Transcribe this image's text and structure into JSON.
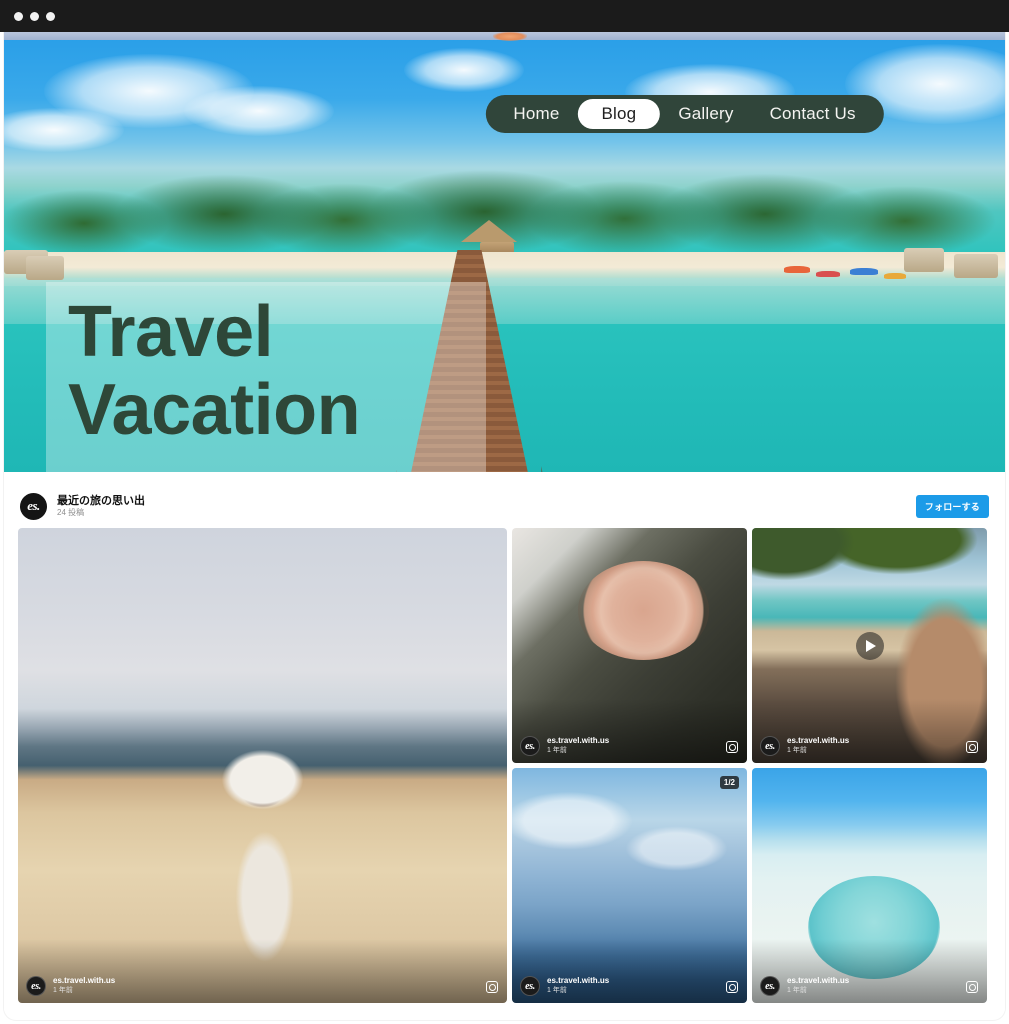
{
  "window": {
    "traffic_dots": [
      "dot-1",
      "dot-2",
      "dot-3"
    ]
  },
  "hero": {
    "title_line1": "Travel",
    "title_line2": "Vacation",
    "overlay_color": "#ffffff",
    "title_color": "#2e4738",
    "nav": {
      "background": "#30453a",
      "active_background": "#ffffff",
      "items": [
        {
          "label": "Home",
          "active": false
        },
        {
          "label": "Blog",
          "active": true
        },
        {
          "label": "Gallery",
          "active": false
        },
        {
          "label": "Contact Us",
          "active": false
        }
      ]
    }
  },
  "instagram": {
    "avatar_text": "es.",
    "account_title": "最近の旅の思い出",
    "post_count": "24 投稿",
    "follow_label": "フォローする",
    "follow_color": "#1c9be8",
    "tiles": [
      {
        "name": "dog-on-beach",
        "username": "es.travel.with.us",
        "time": "1 年前",
        "badge": null,
        "video": false,
        "icon": "instagram-icon"
      },
      {
        "name": "breakfast-bowl-by-the-sea",
        "username": "es.travel.with.us",
        "time": "1 年前",
        "badge": null,
        "video": false,
        "icon": "instagram-icon"
      },
      {
        "name": "hammock-beach-view",
        "username": "es.travel.with.us",
        "time": "1 年前",
        "badge": null,
        "video": true,
        "icon": "instagram-icon"
      },
      {
        "name": "cloudy-ocean-horizon",
        "username": "es.travel.with.us",
        "time": "1 年前",
        "badge": "1/2",
        "video": false,
        "icon": "instagram-icon"
      },
      {
        "name": "blue-sun-hat-on-beach",
        "username": "es.travel.with.us",
        "time": "1 年前",
        "badge": null,
        "video": false,
        "icon": "instagram-icon"
      }
    ]
  }
}
